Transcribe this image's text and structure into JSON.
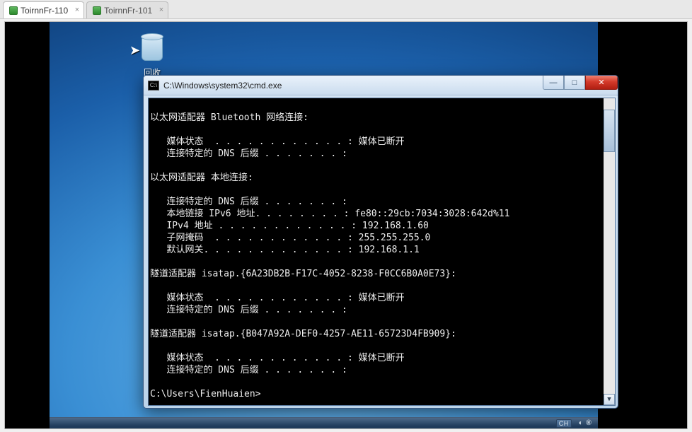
{
  "tabs": [
    {
      "label": "ToirnnFr-110",
      "active": true
    },
    {
      "label": "ToirnnFr-101",
      "active": false
    }
  ],
  "desktop": {
    "recycle_label": "回收"
  },
  "cmd": {
    "title": "C:\\Windows\\system32\\cmd.exe",
    "icon_text": "C:\\",
    "lines": [
      "",
      "以太网适配器 Bluetooth 网络连接:",
      "",
      "   媒体状态  . . . . . . . . . . . . : 媒体已断开",
      "   连接特定的 DNS 后缀 . . . . . . . :",
      "",
      "以太网适配器 本地连接:",
      "",
      "   连接特定的 DNS 后缀 . . . . . . . :",
      "   本地链接 IPv6 地址. . . . . . . . : fe80::29cb:7034:3028:642d%11",
      "   IPv4 地址 . . . . . . . . . . . . : 192.168.1.60",
      "   子网掩码  . . . . . . . . . . . . : 255.255.255.0",
      "   默认网关. . . . . . . . . . . . . : 192.168.1.1",
      "",
      "隧道适配器 isatap.{6A23DB2B-F17C-4052-8238-F0CC6B0A0E73}:",
      "",
      "   媒体状态  . . . . . . . . . . . . : 媒体已断开",
      "   连接特定的 DNS 后缀 . . . . . . . :",
      "",
      "隧道适配器 isatap.{B047A92A-DEF0-4257-AE11-65723D4FB909}:",
      "",
      "   媒体状态  . . . . . . . . . . . . : 媒体已断开",
      "   连接特定的 DNS 后缀 . . . . . . . :",
      "",
      "C:\\Users\\FienHuaien>"
    ]
  },
  "taskbar": {
    "lang": "CH",
    "extra": "◐ ⑧"
  },
  "win_buttons": {
    "min": "—",
    "max": "□",
    "close": "✕"
  }
}
